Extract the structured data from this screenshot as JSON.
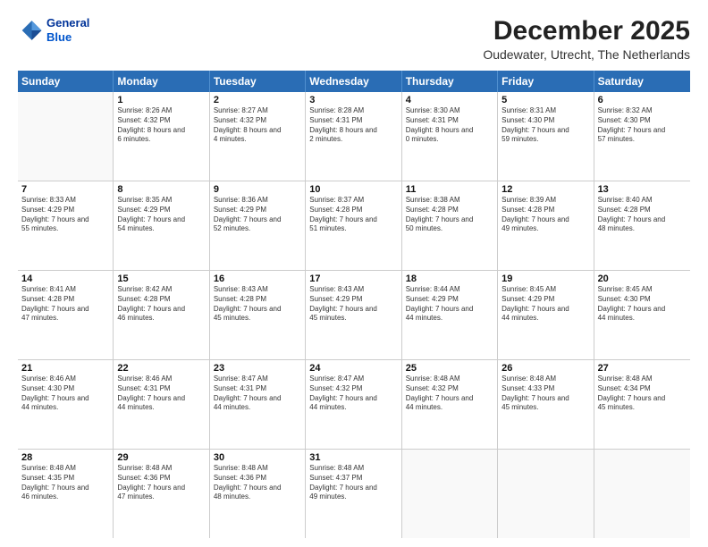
{
  "logo": {
    "line1": "General",
    "line2": "Blue"
  },
  "title": "December 2025",
  "subtitle": "Oudewater, Utrecht, The Netherlands",
  "header_days": [
    "Sunday",
    "Monday",
    "Tuesday",
    "Wednesday",
    "Thursday",
    "Friday",
    "Saturday"
  ],
  "weeks": [
    [
      {
        "day": "",
        "sunrise": "",
        "sunset": "",
        "daylight": ""
      },
      {
        "day": "1",
        "sunrise": "Sunrise: 8:26 AM",
        "sunset": "Sunset: 4:32 PM",
        "daylight": "Daylight: 8 hours and 6 minutes."
      },
      {
        "day": "2",
        "sunrise": "Sunrise: 8:27 AM",
        "sunset": "Sunset: 4:32 PM",
        "daylight": "Daylight: 8 hours and 4 minutes."
      },
      {
        "day": "3",
        "sunrise": "Sunrise: 8:28 AM",
        "sunset": "Sunset: 4:31 PM",
        "daylight": "Daylight: 8 hours and 2 minutes."
      },
      {
        "day": "4",
        "sunrise": "Sunrise: 8:30 AM",
        "sunset": "Sunset: 4:31 PM",
        "daylight": "Daylight: 8 hours and 0 minutes."
      },
      {
        "day": "5",
        "sunrise": "Sunrise: 8:31 AM",
        "sunset": "Sunset: 4:30 PM",
        "daylight": "Daylight: 7 hours and 59 minutes."
      },
      {
        "day": "6",
        "sunrise": "Sunrise: 8:32 AM",
        "sunset": "Sunset: 4:30 PM",
        "daylight": "Daylight: 7 hours and 57 minutes."
      }
    ],
    [
      {
        "day": "7",
        "sunrise": "Sunrise: 8:33 AM",
        "sunset": "Sunset: 4:29 PM",
        "daylight": "Daylight: 7 hours and 55 minutes."
      },
      {
        "day": "8",
        "sunrise": "Sunrise: 8:35 AM",
        "sunset": "Sunset: 4:29 PM",
        "daylight": "Daylight: 7 hours and 54 minutes."
      },
      {
        "day": "9",
        "sunrise": "Sunrise: 8:36 AM",
        "sunset": "Sunset: 4:29 PM",
        "daylight": "Daylight: 7 hours and 52 minutes."
      },
      {
        "day": "10",
        "sunrise": "Sunrise: 8:37 AM",
        "sunset": "Sunset: 4:28 PM",
        "daylight": "Daylight: 7 hours and 51 minutes."
      },
      {
        "day": "11",
        "sunrise": "Sunrise: 8:38 AM",
        "sunset": "Sunset: 4:28 PM",
        "daylight": "Daylight: 7 hours and 50 minutes."
      },
      {
        "day": "12",
        "sunrise": "Sunrise: 8:39 AM",
        "sunset": "Sunset: 4:28 PM",
        "daylight": "Daylight: 7 hours and 49 minutes."
      },
      {
        "day": "13",
        "sunrise": "Sunrise: 8:40 AM",
        "sunset": "Sunset: 4:28 PM",
        "daylight": "Daylight: 7 hours and 48 minutes."
      }
    ],
    [
      {
        "day": "14",
        "sunrise": "Sunrise: 8:41 AM",
        "sunset": "Sunset: 4:28 PM",
        "daylight": "Daylight: 7 hours and 47 minutes."
      },
      {
        "day": "15",
        "sunrise": "Sunrise: 8:42 AM",
        "sunset": "Sunset: 4:28 PM",
        "daylight": "Daylight: 7 hours and 46 minutes."
      },
      {
        "day": "16",
        "sunrise": "Sunrise: 8:43 AM",
        "sunset": "Sunset: 4:28 PM",
        "daylight": "Daylight: 7 hours and 45 minutes."
      },
      {
        "day": "17",
        "sunrise": "Sunrise: 8:43 AM",
        "sunset": "Sunset: 4:29 PM",
        "daylight": "Daylight: 7 hours and 45 minutes."
      },
      {
        "day": "18",
        "sunrise": "Sunrise: 8:44 AM",
        "sunset": "Sunset: 4:29 PM",
        "daylight": "Daylight: 7 hours and 44 minutes."
      },
      {
        "day": "19",
        "sunrise": "Sunrise: 8:45 AM",
        "sunset": "Sunset: 4:29 PM",
        "daylight": "Daylight: 7 hours and 44 minutes."
      },
      {
        "day": "20",
        "sunrise": "Sunrise: 8:45 AM",
        "sunset": "Sunset: 4:30 PM",
        "daylight": "Daylight: 7 hours and 44 minutes."
      }
    ],
    [
      {
        "day": "21",
        "sunrise": "Sunrise: 8:46 AM",
        "sunset": "Sunset: 4:30 PM",
        "daylight": "Daylight: 7 hours and 44 minutes."
      },
      {
        "day": "22",
        "sunrise": "Sunrise: 8:46 AM",
        "sunset": "Sunset: 4:31 PM",
        "daylight": "Daylight: 7 hours and 44 minutes."
      },
      {
        "day": "23",
        "sunrise": "Sunrise: 8:47 AM",
        "sunset": "Sunset: 4:31 PM",
        "daylight": "Daylight: 7 hours and 44 minutes."
      },
      {
        "day": "24",
        "sunrise": "Sunrise: 8:47 AM",
        "sunset": "Sunset: 4:32 PM",
        "daylight": "Daylight: 7 hours and 44 minutes."
      },
      {
        "day": "25",
        "sunrise": "Sunrise: 8:48 AM",
        "sunset": "Sunset: 4:32 PM",
        "daylight": "Daylight: 7 hours and 44 minutes."
      },
      {
        "day": "26",
        "sunrise": "Sunrise: 8:48 AM",
        "sunset": "Sunset: 4:33 PM",
        "daylight": "Daylight: 7 hours and 45 minutes."
      },
      {
        "day": "27",
        "sunrise": "Sunrise: 8:48 AM",
        "sunset": "Sunset: 4:34 PM",
        "daylight": "Daylight: 7 hours and 45 minutes."
      }
    ],
    [
      {
        "day": "28",
        "sunrise": "Sunrise: 8:48 AM",
        "sunset": "Sunset: 4:35 PM",
        "daylight": "Daylight: 7 hours and 46 minutes."
      },
      {
        "day": "29",
        "sunrise": "Sunrise: 8:48 AM",
        "sunset": "Sunset: 4:36 PM",
        "daylight": "Daylight: 7 hours and 47 minutes."
      },
      {
        "day": "30",
        "sunrise": "Sunrise: 8:48 AM",
        "sunset": "Sunset: 4:36 PM",
        "daylight": "Daylight: 7 hours and 48 minutes."
      },
      {
        "day": "31",
        "sunrise": "Sunrise: 8:48 AM",
        "sunset": "Sunset: 4:37 PM",
        "daylight": "Daylight: 7 hours and 49 minutes."
      },
      {
        "day": "",
        "sunrise": "",
        "sunset": "",
        "daylight": ""
      },
      {
        "day": "",
        "sunrise": "",
        "sunset": "",
        "daylight": ""
      },
      {
        "day": "",
        "sunrise": "",
        "sunset": "",
        "daylight": ""
      }
    ]
  ]
}
